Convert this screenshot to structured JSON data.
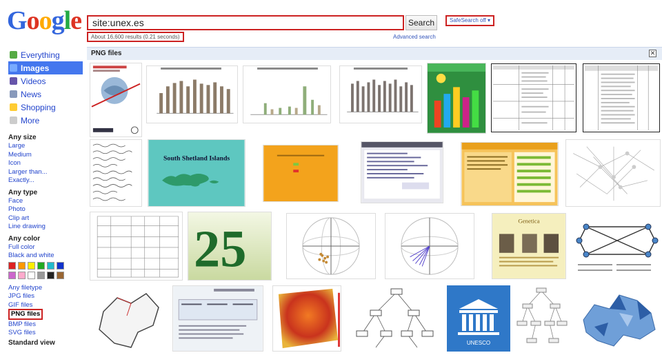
{
  "header": {
    "logo": [
      "G",
      "o",
      "o",
      "g",
      "l",
      "e"
    ],
    "search_value": "site:unex.es",
    "search_button": "Search",
    "safesearch": "SafeSearch off ▾",
    "results_stats": "About 16,600 results (0.21 seconds)",
    "advanced_search": "Advanced search"
  },
  "sidebar": {
    "nav": [
      {
        "label": "Everything",
        "icon": "everything-icon",
        "color": "#55aa44",
        "active": false
      },
      {
        "label": "Images",
        "icon": "images-icon",
        "color": "#77aaff",
        "active": true
      },
      {
        "label": "Videos",
        "icon": "videos-icon",
        "color": "#6655aa",
        "active": false
      },
      {
        "label": "News",
        "icon": "news-icon",
        "color": "#8899bb",
        "active": false
      },
      {
        "label": "Shopping",
        "icon": "shopping-icon",
        "color": "#ffcc33",
        "active": false
      },
      {
        "label": "More",
        "icon": "more-icon",
        "color": "#cccccc",
        "active": false
      }
    ],
    "size_heading": "Any size",
    "size_links": [
      "Large",
      "Medium",
      "Icon",
      "Larger than...",
      "Exactly..."
    ],
    "type_heading": "Any type",
    "type_links": [
      "Face",
      "Photo",
      "Clip art",
      "Line drawing"
    ],
    "color_heading": "Any color",
    "color_links": [
      "Full color",
      "Black and white"
    ],
    "swatches": [
      "#dd2222",
      "#ff9900",
      "#ffee00",
      "#22aa22",
      "#22bbcc",
      "#1133cc",
      "#cc66cc",
      "#ffaacc",
      "#ffffff",
      "#999999",
      "#222222",
      "#996633"
    ],
    "filetype_links": [
      "Any filetype",
      "JPG files",
      "GIF files",
      "PNG files",
      "BMP files",
      "SVG files"
    ],
    "filetype_selected": "PNG files",
    "standard_view": "Standard view"
  },
  "main": {
    "filter_title": "PNG files",
    "close": "✕"
  },
  "thumbs": {
    "row1": [
      "thumb-globe",
      "thumb-bar-1",
      "thumb-bar-2",
      "thumb-bar-3",
      "thumb-colorful",
      "thumb-table-1",
      "thumb-table-2"
    ],
    "row2": [
      "thumb-handwriting",
      "thumb-map-islands",
      "thumb-orange",
      "thumb-screen",
      "thumb-web-orange",
      "thumb-network"
    ],
    "row3": [
      "thumb-table-grid",
      "thumb-25",
      "thumb-sphere-1",
      "thumb-sphere-2",
      "thumb-genetics",
      "thumb-graph"
    ],
    "row4": [
      "thumb-map-outline",
      "thumb-doc",
      "thumb-heatmap",
      "thumb-tree",
      "thumb-unesco",
      "thumb-tree-2",
      "thumb-map-blue"
    ],
    "islands_label": "South Shetland Islands",
    "big_number": "25",
    "genetics_title": "Genetica",
    "unesco_label": "UNESCO"
  }
}
